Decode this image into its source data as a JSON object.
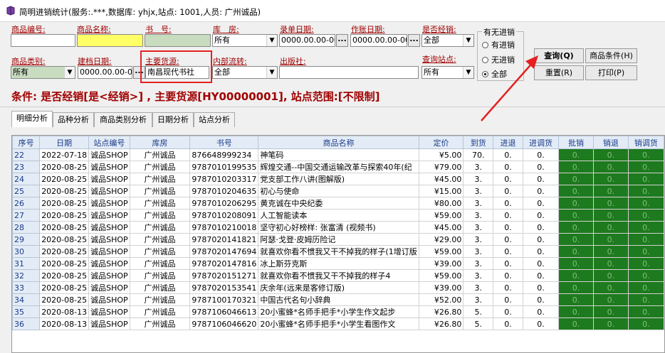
{
  "window": {
    "title": "简明进销统计(服务:.***,数据库: yhjx,站点: 1001,人员: 广州诚品)"
  },
  "filters": {
    "product_code_label": "商品编号:",
    "product_name_label": "商品名称:",
    "book_no_label": "书　号:",
    "warehouse_label": "库　房:",
    "warehouse_value": "所有",
    "entry_date_label": "录单日期:",
    "entry_date_value": "0000.00.00-00",
    "account_date_label": "作账日期:",
    "account_date_value": "0000.00.00-00",
    "consign_label": "是否经销:",
    "consign_value": "全部",
    "category_label": "商品类别:",
    "category_value": "所有",
    "archive_date_label": "建档日期:",
    "archive_date_value": "0000.00.00-0(",
    "main_supplier_label": "主要货源:",
    "main_supplier_value": "南昌现代书社",
    "internal_transfer_label": "内部流转:",
    "internal_transfer_value": "全部",
    "publisher_label": "出版社:",
    "query_site_label": "查询站点:",
    "query_site_value": "所有",
    "dots": "..."
  },
  "stock_group": {
    "title": "有无进销",
    "options": [
      "有进销",
      "无进销",
      "全部"
    ],
    "selected": "全部"
  },
  "buttons": {
    "query": "查询(Q)",
    "product_condition": "商品条件(H)",
    "reset": "重置(R)",
    "print": "打印(P)"
  },
  "condition_text": "条件: 是否经销[是<经销>] , 主要货源[HY00000001], 站点范围:[不限制]",
  "tabs": [
    "明细分析",
    "品种分析",
    "商品类别分析",
    "日期分析",
    "站点分析"
  ],
  "active_tab": "明细分析",
  "table": {
    "columns": [
      "序号",
      "日期",
      "站点编号",
      "库房",
      "书号",
      "商品名称",
      "定价",
      "到货",
      "进退",
      "进调货",
      "批销",
      "销退",
      "销调货"
    ],
    "rows": [
      [
        "22",
        "2022-07-18",
        "诚品SHOP",
        "广州诚品",
        "876648999234",
        "神笔码",
        "¥5.00",
        "70.",
        "0.",
        "0.",
        "0.",
        "0.",
        "0."
      ],
      [
        "23",
        "2020-08-25",
        "诚品SHOP",
        "广州诚品",
        "9787010199535",
        "辉煌交通--中国交通运输改革与探索40年(纪",
        "¥79.00",
        "3.",
        "0.",
        "0.",
        "0.",
        "0.",
        "0."
      ],
      [
        "24",
        "2020-08-25",
        "诚品SHOP",
        "广州诚品",
        "9787010203317",
        "党支部工作八讲(图解版)",
        "¥45.00",
        "3.",
        "0.",
        "0.",
        "0.",
        "0.",
        "0."
      ],
      [
        "25",
        "2020-08-25",
        "诚品SHOP",
        "广州诚品",
        "9787010204635",
        "初心与使命",
        "¥15.00",
        "3.",
        "0.",
        "0.",
        "0.",
        "0.",
        "0."
      ],
      [
        "26",
        "2020-08-25",
        "诚品SHOP",
        "广州诚品",
        "9787010206295",
        "黄克诚在中央纪委",
        "¥80.00",
        "3.",
        "0.",
        "0.",
        "0.",
        "0.",
        "0."
      ],
      [
        "27",
        "2020-08-25",
        "诚品SHOP",
        "广州诚品",
        "9787010208091",
        "人工智能读本",
        "¥59.00",
        "3.",
        "0.",
        "0.",
        "0.",
        "0.",
        "0."
      ],
      [
        "28",
        "2020-08-25",
        "诚品SHOP",
        "广州诚品",
        "9787010210018",
        "坚守初心好榜样: 张富清 (视频书)",
        "¥45.00",
        "3.",
        "0.",
        "0.",
        "0.",
        "0.",
        "0."
      ],
      [
        "29",
        "2020-08-25",
        "诚品SHOP",
        "广州诚品",
        "9787020141821",
        "阿瑟·戈登·皮姆历险记",
        "¥29.00",
        "3.",
        "0.",
        "0.",
        "0.",
        "0.",
        "0."
      ],
      [
        "30",
        "2020-08-25",
        "诚品SHOP",
        "广州诚品",
        "9787020147694",
        "就喜欢你看不惯我又干不掉我的样子(1增订版",
        "¥59.00",
        "3.",
        "0.",
        "0.",
        "0.",
        "0.",
        "0."
      ],
      [
        "31",
        "2020-08-25",
        "诚品SHOP",
        "广州诚品",
        "9787020147816",
        "冰上斯芬克斯",
        "¥39.00",
        "3.",
        "0.",
        "0.",
        "0.",
        "0.",
        "0."
      ],
      [
        "32",
        "2020-08-25",
        "诚品SHOP",
        "广州诚品",
        "9787020151271",
        "就喜欢你看不惯我又干不掉我的样子4",
        "¥59.00",
        "3.",
        "0.",
        "0.",
        "0.",
        "0.",
        "0."
      ],
      [
        "33",
        "2020-08-25",
        "诚品SHOP",
        "广州诚品",
        "9787020153541",
        "庆余年(远来是客修订版)",
        "¥39.00",
        "3.",
        "0.",
        "0.",
        "0.",
        "0.",
        "0."
      ],
      [
        "34",
        "2020-08-25",
        "诚品SHOP",
        "广州诚品",
        "9787100170321",
        "中国古代名句小辞典",
        "¥52.00",
        "3.",
        "0.",
        "0.",
        "0.",
        "0.",
        "0."
      ],
      [
        "35",
        "2020-08-13",
        "诚品SHOP",
        "广州诚品",
        "9787106046613",
        "20小蜜蜂*名师手把手*小学生作文起步",
        "¥26.80",
        "5.",
        "0.",
        "0.",
        "0.",
        "0.",
        "0."
      ],
      [
        "36",
        "2020-08-13",
        "诚品SHOP",
        "广州诚品",
        "9787106046620",
        "20小蜜蜂*名师手把手*小学生看图作文",
        "¥26.80",
        "5.",
        "0.",
        "0.",
        "0.",
        "0.",
        "0."
      ]
    ]
  },
  "colors": {
    "label_red": "#a00000",
    "green_cell": "#1e7a1e",
    "highlight": "#e62020"
  }
}
